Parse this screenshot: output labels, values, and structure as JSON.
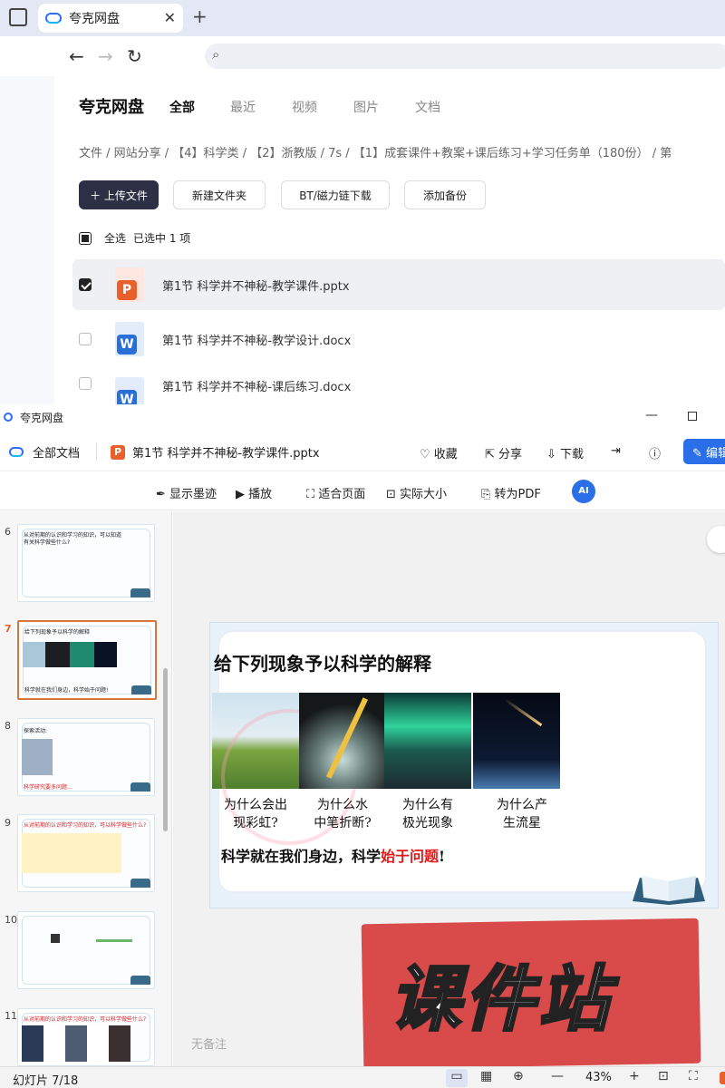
{
  "browser": {
    "tab_title": "夸克网盘",
    "new_tab": "+",
    "close": "✕",
    "back": "←",
    "forward": "→",
    "reload": "↻",
    "search_glyph": "⌕"
  },
  "drive": {
    "brand": "夸克网盘",
    "tabs": [
      "全部",
      "最近",
      "视频",
      "图片",
      "文档"
    ],
    "breadcrumb": "文件 / 网站分享 / 【4】科学类 / 【2】浙教版 / 7s / 【1】成套课件+教案+课后练习+学习任务单（180份） / 第",
    "buttons": {
      "upload": "＋ 上传文件",
      "new_folder": "新建文件夹",
      "bt": "BT/磁力链下载",
      "backup": "添加备份"
    },
    "select_all": "全选",
    "selected_info": "已选中  1  项",
    "files": [
      {
        "name": "第1节 科学并不神秘-教学课件.pptx",
        "type": "ppt",
        "checked": true
      },
      {
        "name": "第1节 科学并不神秘-教学设计.docx",
        "type": "doc",
        "checked": false
      },
      {
        "name": "第1节 科学并不神秘-课后练习.docx",
        "type": "doc",
        "checked": false
      }
    ]
  },
  "viewer": {
    "window_title": "夸克网盘",
    "min": "—",
    "all_docs": "全部文档",
    "file_name": "第1节 科学并不神秘-教学课件.pptx",
    "actions": {
      "collect": "♡ 收藏",
      "share": "⇱ 分享",
      "download": "⇩ 下载",
      "more1": "⇥",
      "more2": "ⓘ",
      "edit": "✎ 编辑"
    },
    "tools": {
      "ink": "显示墨迹",
      "play": "播放",
      "fit": "适合页面",
      "actual": "实际大小",
      "pdf": "转为PDF",
      "ai": "AI"
    },
    "thumbs": [
      {
        "num": "6",
        "lines": [
          "从对前期的认识和学习的知识，可以知道",
          "有关科学做些什么?"
        ]
      },
      {
        "num": "7",
        "lines": [
          "给下列现象予以科学的解释",
          "科学就在我们身边，科学始于问题!"
        ]
      },
      {
        "num": "8",
        "lines": [
          "探索活动:",
          "科学研究要多问题..."
        ]
      },
      {
        "num": "9",
        "lines": [
          "从对前期的认识和学习的知识，可以科学做些什么?"
        ]
      },
      {
        "num": "10",
        "lines": [
          ""
        ]
      },
      {
        "num": "11",
        "lines": [
          "从对前期的认识和学习的知识，可以科学做些什么?"
        ]
      }
    ],
    "slide": {
      "title": "给下列现象予以科学的解释",
      "captions": [
        [
          "为什么会出",
          "现彩虹?"
        ],
        [
          "为什么水",
          "中笔折断?"
        ],
        [
          "为什么有",
          "极光现象"
        ],
        [
          "为什么产",
          "生流星"
        ]
      ],
      "line_prefix": "科学就在我们身边，科学",
      "line_highlight": "始于问题",
      "line_suffix": "!"
    },
    "watermark": "课件站",
    "notes": "无备注",
    "status": {
      "slide_count": "幻灯片 7/18",
      "zoom": "43%",
      "minus": "—",
      "plus": "+"
    }
  },
  "colors": {
    "accent": "#2a6fe8",
    "ppt": "#e8612c",
    "highlight": "#e01a1a",
    "watermark": "#d94a4a"
  }
}
